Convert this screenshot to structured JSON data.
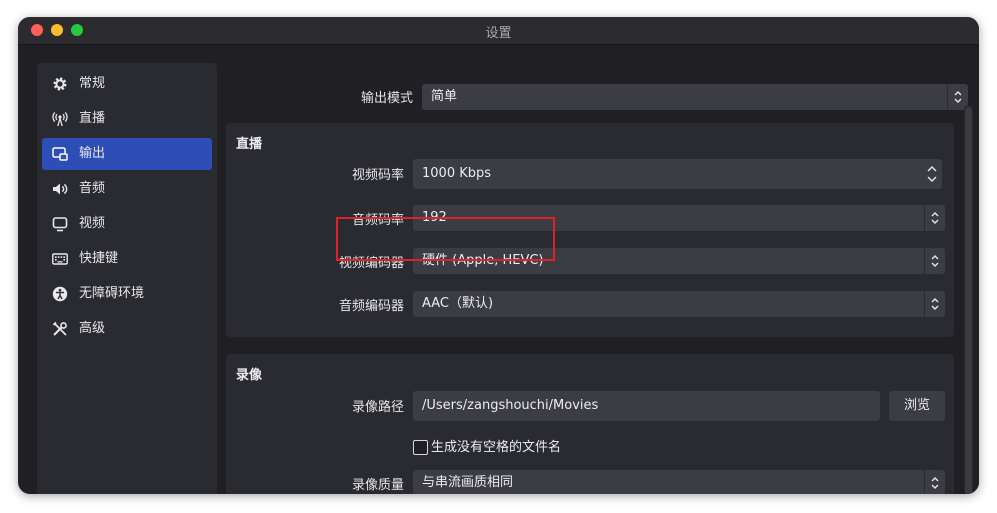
{
  "window": {
    "title": "设置"
  },
  "sidebar": {
    "items": [
      {
        "label": "常规",
        "icon": "gear-icon"
      },
      {
        "label": "直播",
        "icon": "broadcast-icon"
      },
      {
        "label": "输出",
        "icon": "output-icon",
        "selected": true
      },
      {
        "label": "音频",
        "icon": "speaker-icon"
      },
      {
        "label": "视频",
        "icon": "monitor-icon"
      },
      {
        "label": "快捷键",
        "icon": "keyboard-icon"
      },
      {
        "label": "无障碍环境",
        "icon": "accessibility-icon"
      },
      {
        "label": "高级",
        "icon": "tools-icon"
      }
    ]
  },
  "output_mode": {
    "label": "输出模式",
    "value": "简单"
  },
  "streaming": {
    "title": "直播",
    "video_bitrate": {
      "label": "视频码率",
      "value": "1000 Kbps"
    },
    "audio_bitrate": {
      "label": "音频码率",
      "value": "192"
    },
    "video_encoder": {
      "label": "视频编码器",
      "value": "硬件 (Apple, HEVC)"
    },
    "audio_encoder": {
      "label": "音频编码器",
      "value": "AAC（默认)"
    }
  },
  "recording": {
    "title": "录像",
    "path": {
      "label": "录像路径",
      "value": "/Users/zangshouchi/Movies",
      "browse_label": "浏览"
    },
    "no_space_filename": {
      "label": "生成没有空格的文件名",
      "checked": false
    },
    "quality": {
      "label": "录像质量",
      "value": "与串流画质相同"
    }
  },
  "colors": {
    "accent": "#2d4db7",
    "highlight_box": "#e0212b",
    "background": "#1f1f24",
    "panel": "#2a2b31"
  }
}
